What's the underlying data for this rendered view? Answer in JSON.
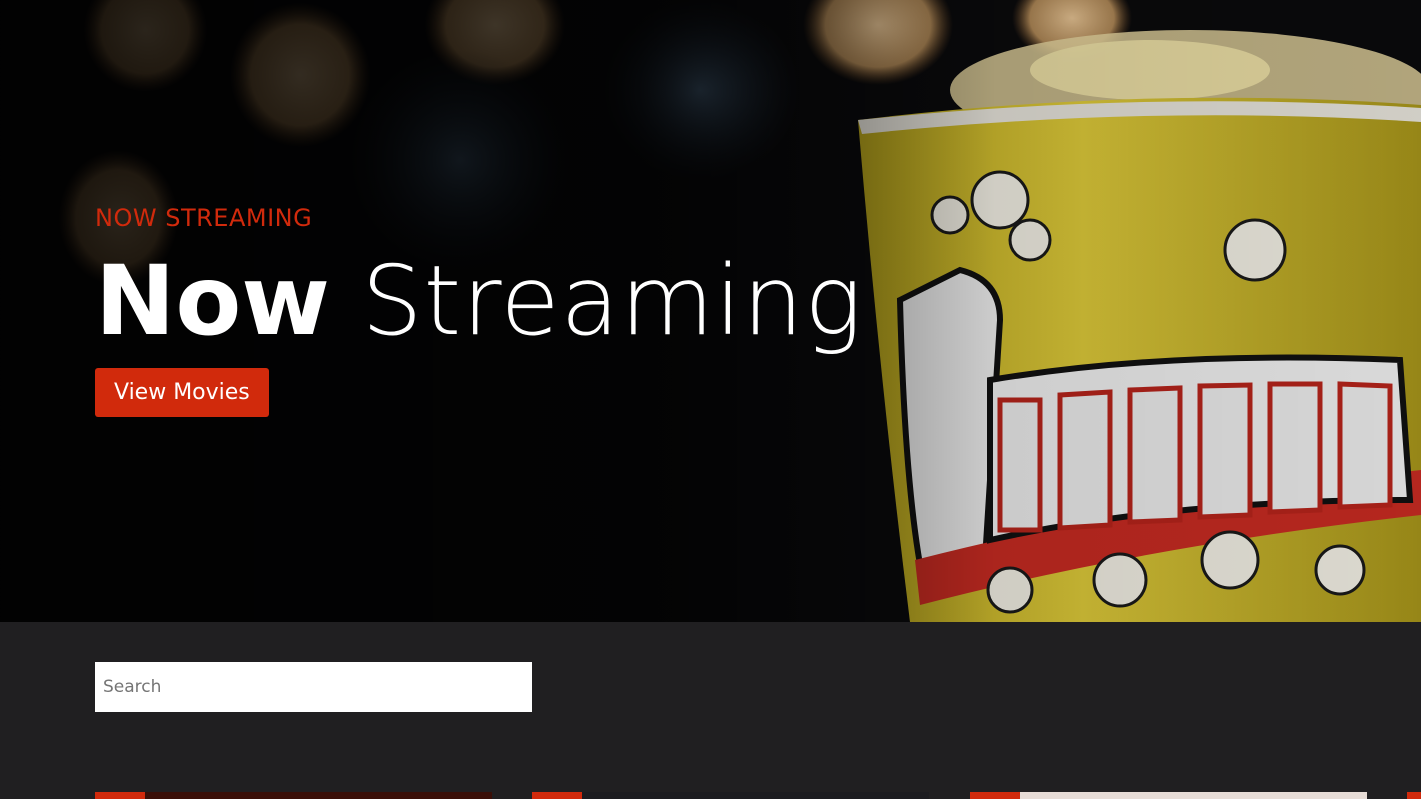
{
  "hero": {
    "eyebrow": "NOW STREAMING",
    "title_strong": "Now",
    "title_light": "Streaming",
    "cta_label": "View Movies",
    "background_image": "popcorn-bucket-photo"
  },
  "search": {
    "placeholder": "Search",
    "value": ""
  },
  "cards": [
    {
      "tag_color": "#d12a0c",
      "image_color": "#3a0f08"
    },
    {
      "tag_color": "#d12a0c",
      "image_color": "#1c1c20"
    },
    {
      "tag_color": "#d12a0c",
      "image_color": "#e7dcd6"
    },
    {
      "tag_color": "#d12a0c",
      "image_color": "#d12a0c"
    }
  ],
  "colors": {
    "accent": "#d12a0c",
    "page_background": "#201f21",
    "text": "#ffffff"
  }
}
